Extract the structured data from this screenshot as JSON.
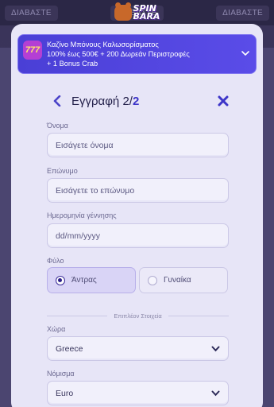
{
  "background": {
    "tabs": [
      "ΔΙΑΒΑΣΤΕ",
      "ΔΙΑΒΑΣΤΕ",
      "ΔΙΑΒΑΣΤΕ"
    ]
  },
  "logo": {
    "line1": "SPIN",
    "line2": "BARA"
  },
  "banner": {
    "badge": "777",
    "line1": "Καζίνο Μπόνους Καλωσορίσματος",
    "line2": "100% έως 500€ + 200 Δωρεάν Περιστροφές",
    "line3": "+ 1 Bonus Crab"
  },
  "step": {
    "title": "Εγγραφή 2/",
    "title_accent": "2"
  },
  "form": {
    "first_name_label": "Όνομα",
    "first_name_placeholder": "Εισάγετε όνομα",
    "last_name_label": "Επώνυμο",
    "last_name_placeholder": "Εισάγετε το επώνυμο",
    "birth_label": "Ημερομηνία γέννησης",
    "birth_placeholder": "dd/mm/yyyy",
    "gender_label": "Φύλο",
    "gender_male": "Άντρας",
    "gender_female": "Γυναίκα",
    "gender_selected": "Άντρας",
    "divider_text": "Επιπλέον Στοιχεία",
    "country_label": "Χώρα",
    "country_value": "Greece",
    "currency_label": "Νόμισμα",
    "currency_value": "Euro"
  },
  "colors": {
    "accent": "#3d35c8",
    "banner": "#4a3fd6",
    "modal_bg": "#e7e5f7"
  }
}
